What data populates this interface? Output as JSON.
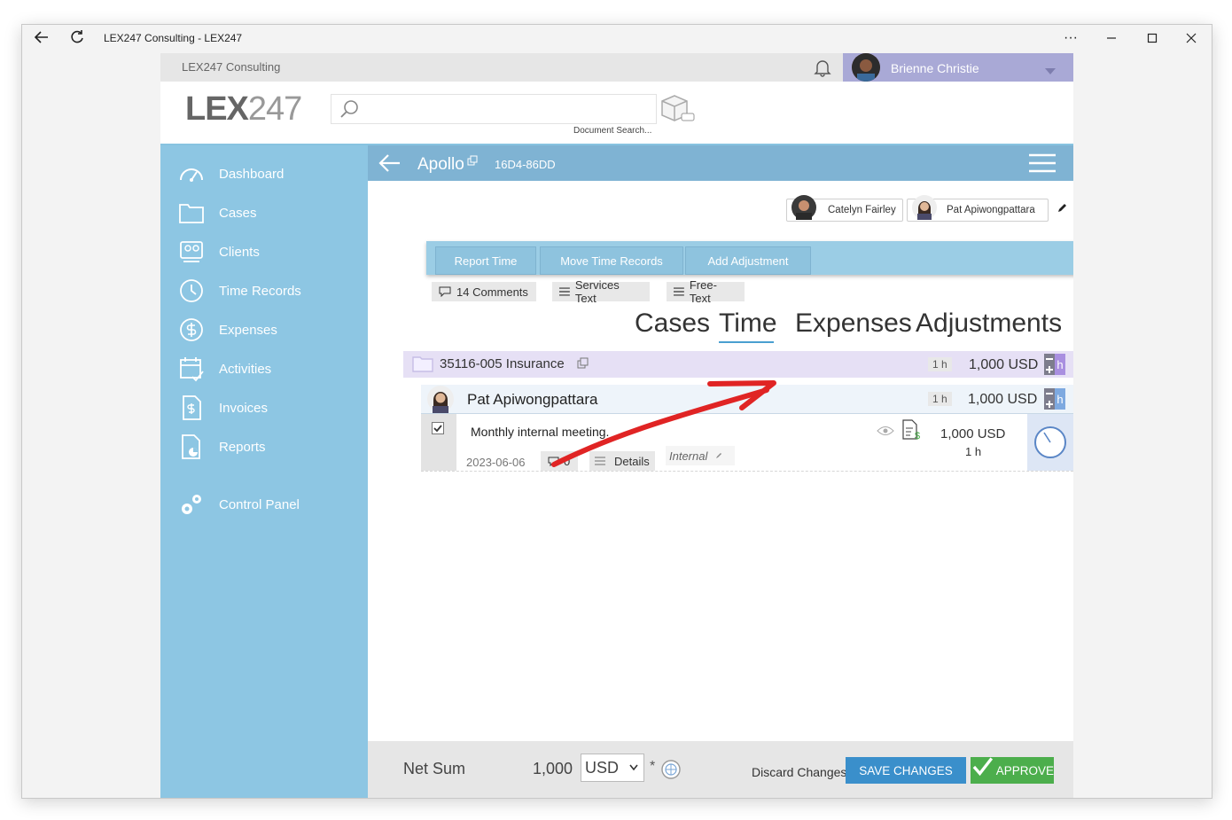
{
  "window": {
    "title": "LEX247 Consulting - LEX247",
    "more_label": "···"
  },
  "topbar": {
    "org_name": "LEX247 Consulting",
    "user_name": "Brienne Christie"
  },
  "logo": {
    "text_bold": "LEX",
    "text_light": "247"
  },
  "search": {
    "placeholder": "",
    "caption": "Document Search..."
  },
  "sidebar": {
    "items": [
      {
        "label": "Dashboard",
        "icon": "dashboard-icon"
      },
      {
        "label": "Cases",
        "icon": "folder-icon"
      },
      {
        "label": "Clients",
        "icon": "clients-icon"
      },
      {
        "label": "Time Records",
        "icon": "clock-icon"
      },
      {
        "label": "Expenses",
        "icon": "dollar-icon"
      },
      {
        "label": "Activities",
        "icon": "calendar-icon"
      },
      {
        "label": "Invoices",
        "icon": "invoice-icon"
      },
      {
        "label": "Reports",
        "icon": "reports-icon"
      },
      {
        "label": "Control Panel",
        "icon": "gears-icon"
      }
    ]
  },
  "header": {
    "title": "Apollo",
    "code": "16D4-86DD"
  },
  "assignees": [
    {
      "name": "Catelyn Fairley"
    },
    {
      "name": "Pat Apiwongpattara"
    }
  ],
  "actions": {
    "report_time": "Report Time",
    "move_time_records": "Move Time Records",
    "add_adjustment": "Add Adjustment"
  },
  "subactions": {
    "comments": "14 Comments",
    "services_text": "Services Text",
    "free_text": "Free-Text"
  },
  "tabs": {
    "cases": "Cases",
    "time": "Time",
    "expenses": "Expenses",
    "adjustments": "Adjustments",
    "active": "Time"
  },
  "case_row": {
    "name": "35116-005 Insurance",
    "hours": "1 h",
    "amount": "1,000 USD"
  },
  "person_row": {
    "name": "Pat Apiwongpattara",
    "hours": "1 h",
    "amount": "1,000 USD"
  },
  "entry": {
    "description": "Monthly internal meeting.",
    "date": "2023-06-06",
    "comments_count": "0",
    "details_label": "Details",
    "tag": "Internal",
    "amount": "1,000 USD",
    "hours": "1 h",
    "checked": true
  },
  "footer": {
    "net_sum_label": "Net Sum",
    "net_sum_value": "1,000",
    "currency": "USD",
    "currency_options": [
      "USD"
    ],
    "asterisk": "*",
    "discard_label": "Discard Changes",
    "save_label": "SAVE CHANGES",
    "approve_label": "APPROVE"
  },
  "colors": {
    "sidebar": "#8dc6e3",
    "header": "#7fb3d3",
    "case_row": "#e6e0f5",
    "save_button": "#3a8fcb",
    "approve_button": "#4cae4c",
    "annotation_arrow": "#e02424",
    "user_bar": "#a9a9d6"
  }
}
